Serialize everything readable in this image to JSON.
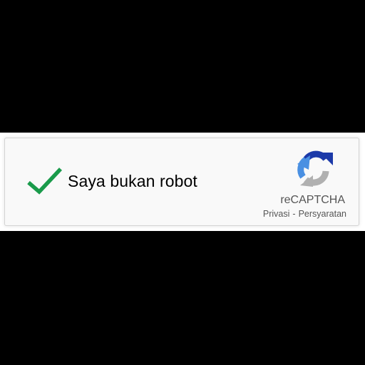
{
  "captcha": {
    "checkbox_label": "Saya bukan robot",
    "checked": true,
    "brand_name": "reCAPTCHA",
    "privacy_link": "Privasi",
    "separator": "-",
    "terms_link": "Persyaratan",
    "icons": {
      "checkmark": "check-icon",
      "logo": "recaptcha-logo-icon"
    }
  },
  "colors": {
    "check_green": "#1a9b4b",
    "logo_blue_dark": "#1c3aa9",
    "logo_blue_light": "#4a90e2",
    "logo_gray": "#b0b0b0",
    "text": "#000000",
    "secondary_text": "#555555"
  }
}
